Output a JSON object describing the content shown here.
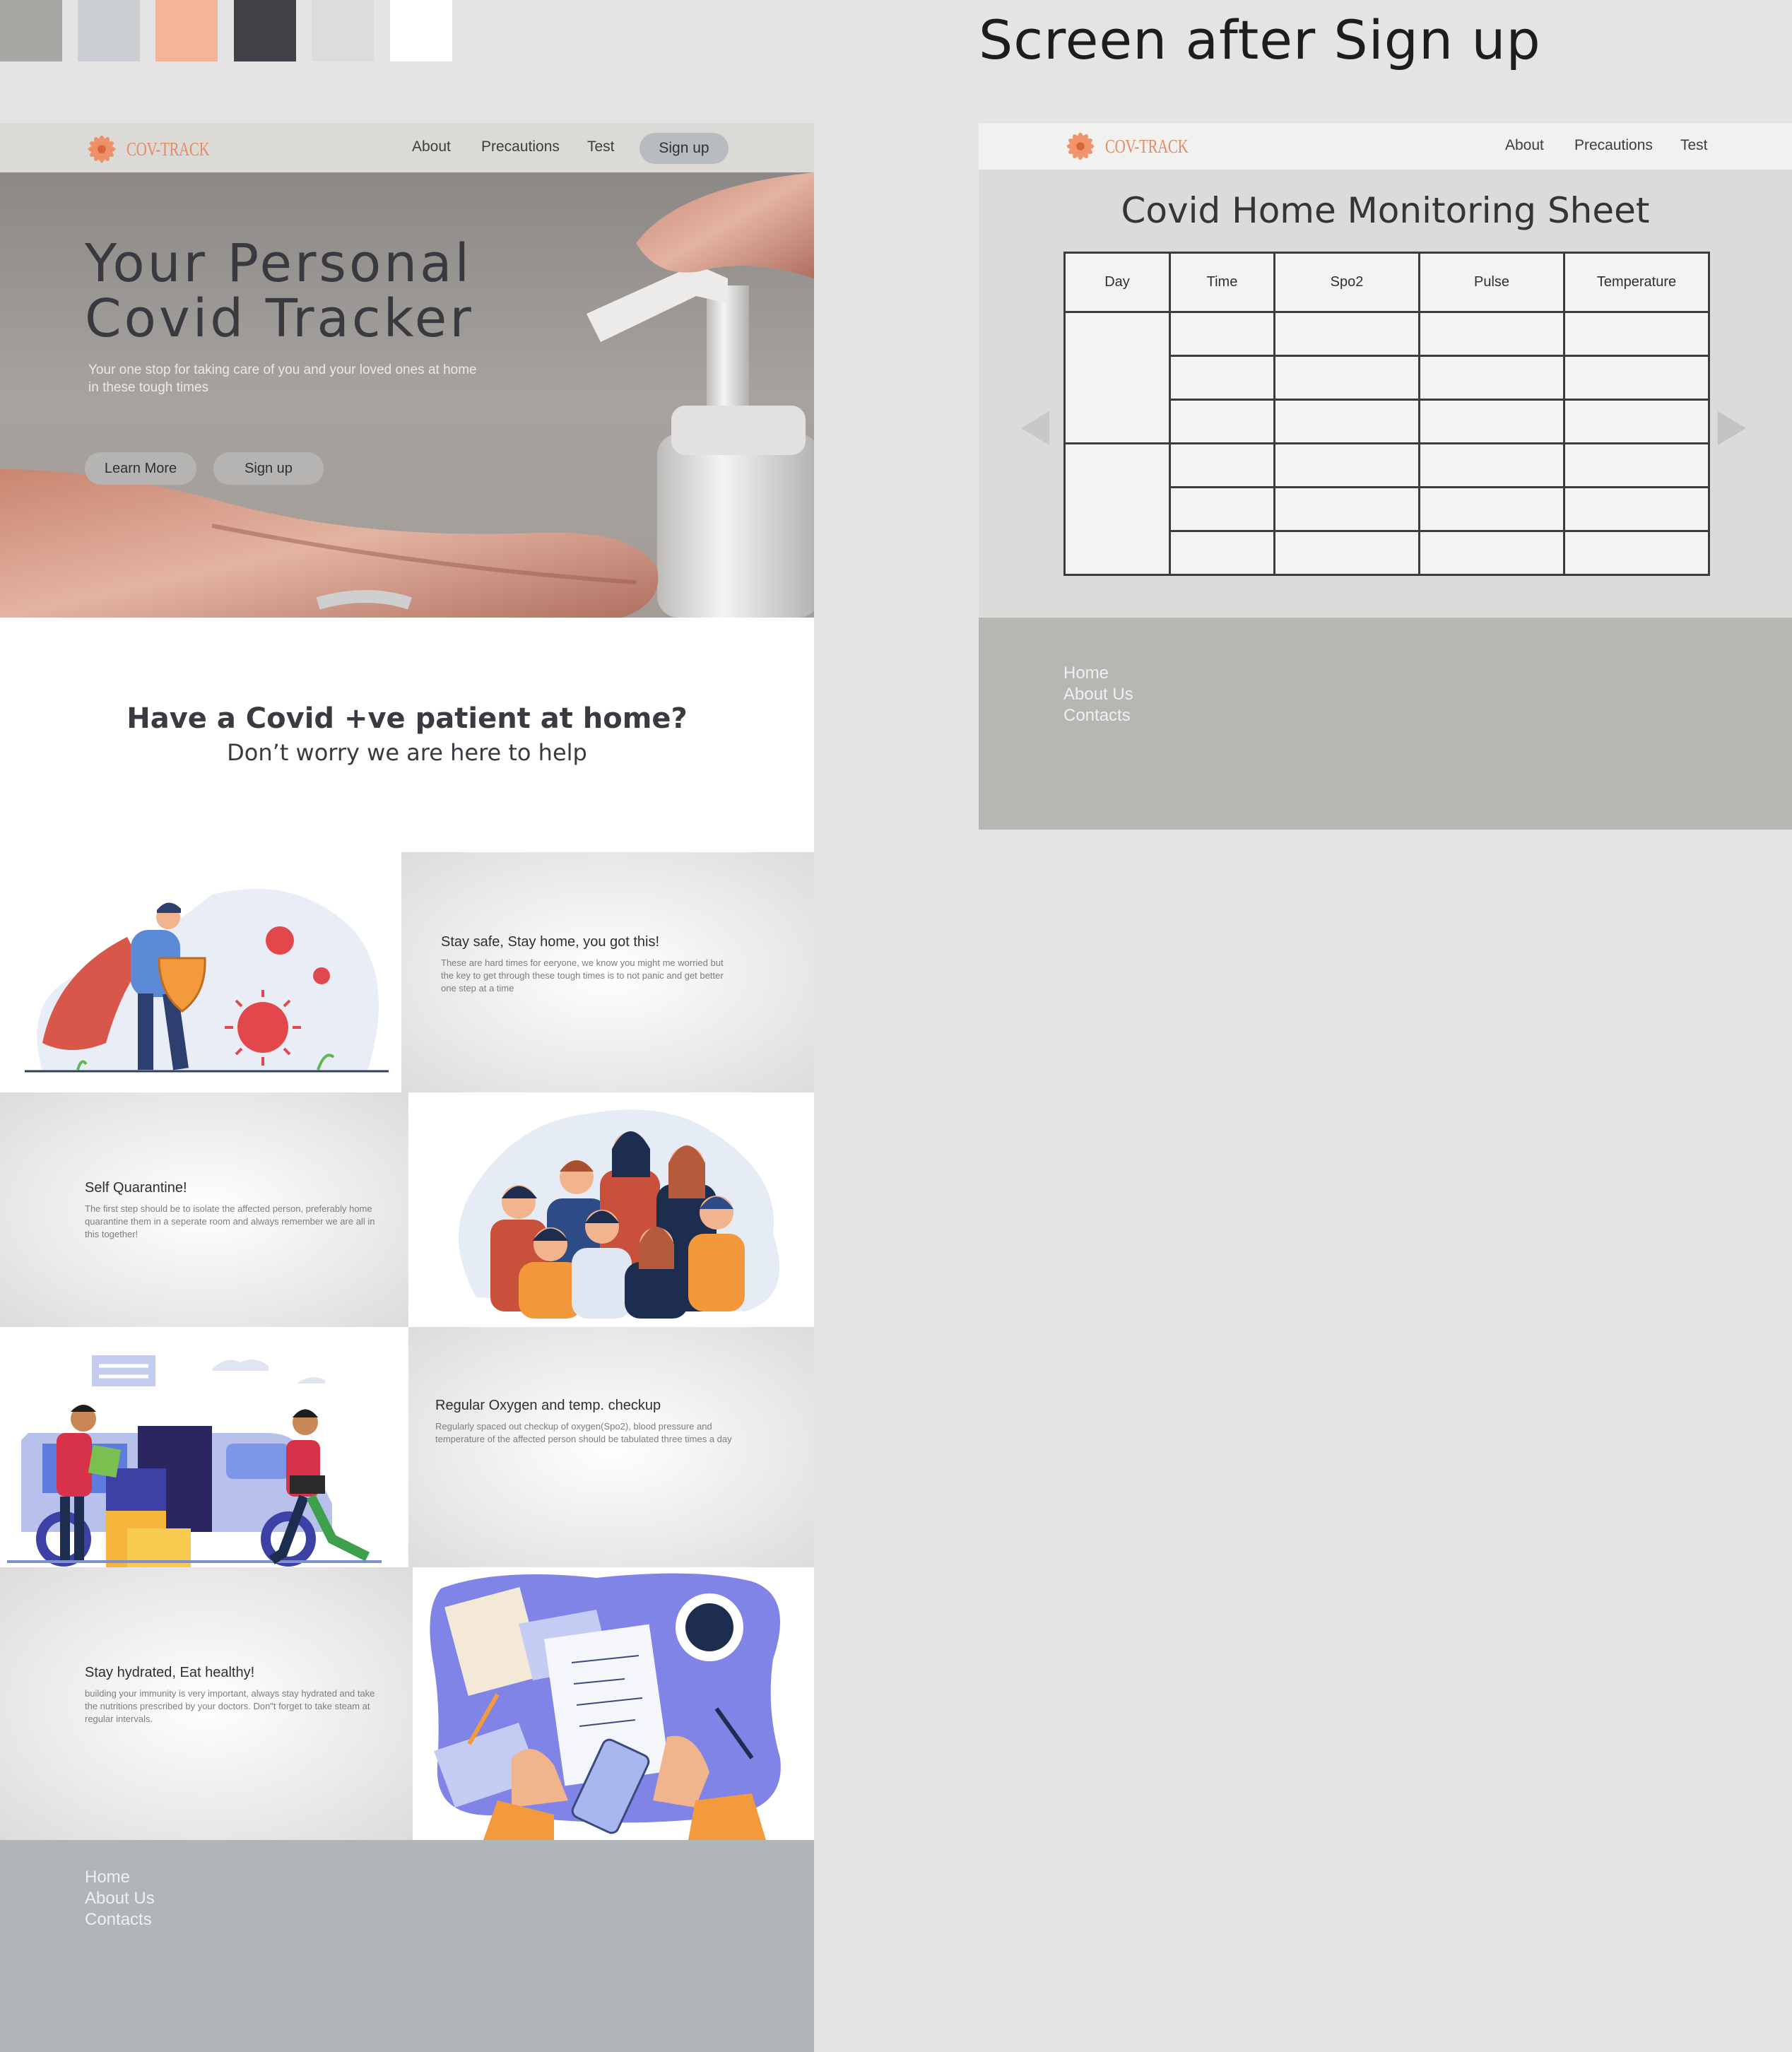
{
  "palette": [
    "#a8a7a4",
    "#cbced2",
    "#f4b499",
    "#404248",
    "#dcdcda",
    "#ffffff"
  ],
  "screen_title": "Screen after Sign up",
  "brand": {
    "name": "COV-TRACK",
    "color": "#e58b66"
  },
  "landing": {
    "nav": {
      "about": "About",
      "precautions": "Precautions",
      "test": "Test",
      "signup": "Sign up"
    },
    "hero": {
      "title_line1": "Your Personal",
      "title_line2": "Covid Tracker",
      "subtitle": "Your one stop for taking care of you and your loved ones at home in these tough times",
      "learn_more": "Learn More",
      "signup": "Sign up"
    },
    "help": {
      "title": "Have a Covid +ve patient at home?",
      "subtitle": "Don’t worry we are here to help"
    },
    "features": [
      {
        "title": "Stay safe, Stay home, you got this!",
        "body": "These are hard times for eeryone, we know you might me worried but the key to get through these tough times is to not panic and get better one step at a time",
        "illustration": "superhero-virus-illustration"
      },
      {
        "title": "Self Quarantine!",
        "body": "The first step should be to isolate the affected person, preferably home quarantine them in a seperate room and always remember we are all in this together!",
        "illustration": "masked-crowd-illustration"
      },
      {
        "title": "Regular Oxygen and temp. checkup",
        "body": "Regularly spaced out checkup of oxygen(Spo2), blood pressure and temperature of the affected person should be tabulated three times a day",
        "illustration": "delivery-van-illustration"
      },
      {
        "title": "Stay hydrated, Eat healthy!",
        "body": "building your immunity is very important, always stay hydrated and take the nutritions prescribed by your doctors. Don\"t forget to take steam at regular intervals.",
        "illustration": "desk-notes-illustration"
      }
    ],
    "footer": [
      "Home",
      "About Us",
      "Contacts"
    ]
  },
  "monitor": {
    "nav": {
      "about": "About",
      "precautions": "Precautions",
      "test": "Test"
    },
    "title": "Covid Home Monitoring Sheet",
    "columns": [
      "Day",
      "Time",
      "Spo2",
      "Pulse",
      "Temperature"
    ],
    "footer": [
      "Home",
      "About Us",
      "Contacts"
    ]
  }
}
